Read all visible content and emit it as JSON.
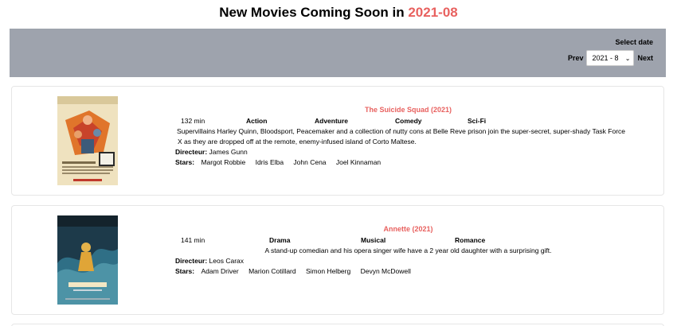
{
  "header": {
    "title_prefix": "New Movies Coming Soon in",
    "title_month": "2021-08"
  },
  "filter": {
    "label": "Select date",
    "prev_label": "Prev",
    "next_label": "Next",
    "selected_month": "2021 - 8"
  },
  "movies": [
    {
      "title": "The Suicide Squad (2021)",
      "runtime": "132 min",
      "genres": [
        "Action",
        "Adventure",
        "Comedy",
        "Sci-Fi"
      ],
      "plot_line1": "Supervillains Harley Quinn, Bloodsport, Peacemaker and a collection of nutty cons at Belle Reve prison join the super-secret, super-shady Task Force",
      "plot_line2": "X as they are dropped off at the remote, enemy-infused island of Corto Maltese.",
      "director_label": "Directeur:",
      "director": "James Gunn",
      "stars_label": "Stars:",
      "stars": [
        "Margot Robbie",
        "Idris Elba",
        "John Cena",
        "Joel Kinnaman"
      ]
    },
    {
      "title": "Annette (2021)",
      "runtime": "141 min",
      "genres": [
        "Drama",
        "Musical",
        "Romance"
      ],
      "plot_line1": "A stand-up comedian and his opera singer wife have a 2 year old daughter with a surprising gift.",
      "director_label": "Directeur:",
      "director": "Leos Carax",
      "stars_label": "Stars:",
      "stars": [
        "Adam Driver",
        "Marion Cotillard",
        "Simon Helberg",
        "Devyn McDowell"
      ]
    }
  ],
  "colors": {
    "accent": "#e8615f",
    "filter_bar": "#9ea3ad"
  }
}
